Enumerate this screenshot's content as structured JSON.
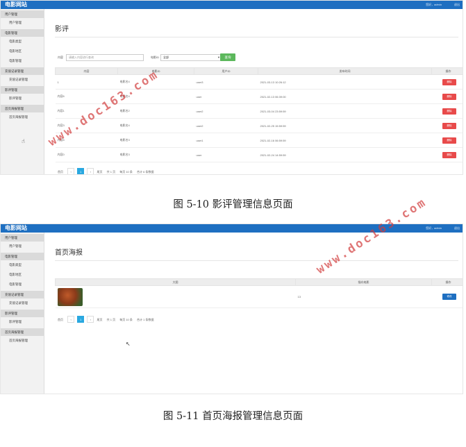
{
  "app": {
    "logo": "电影网站",
    "user": "您好，admin",
    "logout": "退出"
  },
  "sidebar": {
    "items": [
      {
        "label": "用户管理",
        "type": "group"
      },
      {
        "label": "用户管理",
        "type": "item"
      },
      {
        "label": "电影管理",
        "type": "group"
      },
      {
        "label": "电影类型",
        "type": "item"
      },
      {
        "label": "电影地区",
        "type": "item"
      },
      {
        "label": "电影管理",
        "type": "item"
      },
      {
        "label": "充值记录管理",
        "type": "group"
      },
      {
        "label": "充值记录管理",
        "type": "item"
      },
      {
        "label": "影评管理",
        "type": "group"
      },
      {
        "label": "影评管理",
        "type": "item"
      },
      {
        "label": "首页海报管理",
        "type": "group"
      },
      {
        "label": "首页海报管理",
        "type": "item"
      }
    ]
  },
  "review_page": {
    "title": "影评",
    "search": {
      "content_label": "内容",
      "content_placeholder": "请输入内容进行查询",
      "movie_label": "电影ID",
      "movie_value": "全部",
      "query_button": "查询"
    },
    "columns": [
      "内容",
      "电影ID",
      "用户ID",
      "发布时间",
      "操作"
    ],
    "rows": [
      {
        "content": "1",
        "movie": "电影名4",
        "user": "user3",
        "time": "2021-03-13 10:26:12",
        "action": "删除"
      },
      {
        "content": "内容6",
        "movie": "电影名4",
        "user": "user",
        "time": "2021-02-13 06:39:00",
        "action": "删除"
      },
      {
        "content": "内容1",
        "movie": "电影名2",
        "user": "user2",
        "time": "2021-03-04 23:59:59",
        "action": "删除"
      },
      {
        "content": "内容3",
        "movie": "电影名4",
        "user": "user2",
        "time": "2021-02-25 15:59:59",
        "action": "删除"
      },
      {
        "content": "内容5",
        "movie": "电影名3",
        "user": "user1",
        "time": "2021-02-16 06:59:59",
        "action": "删除"
      },
      {
        "content": "内容0",
        "movie": "电影名3",
        "user": "user",
        "time": "2021-02-24 14:59:59",
        "action": "删除"
      }
    ],
    "pager": {
      "first": "首页",
      "prev": "‹",
      "page": "1",
      "next": "›",
      "last": "尾页",
      "total_pages": "共 1 页",
      "per_page": "每页 10 条",
      "total": "合计 6 条数据"
    }
  },
  "caption1": "图 5-10 影评管理信息页面",
  "poster_page": {
    "title": "首页海报",
    "columns": [
      "大图",
      "指向电影",
      "操作"
    ],
    "rows": [
      {
        "target": "13",
        "action": "修改"
      }
    ],
    "pager": {
      "first": "首页",
      "prev": "‹",
      "page": "1",
      "next": "›",
      "last": "尾页",
      "total_pages": "共 1 页",
      "per_page": "每页 10 条",
      "total": "合计 1 条数据"
    }
  },
  "caption2": "图 5-11 首页海报管理信息页面",
  "watermarks": [
    "www.doc163.com",
    "www.doc163.com"
  ],
  "colors": {
    "topbar": "#1e6fc1",
    "delete": "#e84a4a",
    "query": "#5cb85c",
    "page_active": "#2aa8e0"
  }
}
